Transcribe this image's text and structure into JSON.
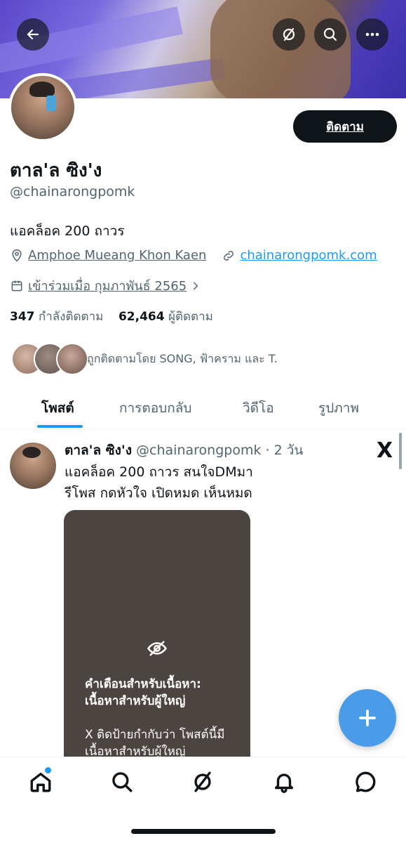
{
  "profile": {
    "name": "ตาล'ล ซิง'ง",
    "handle": "@chainarongpomk",
    "bio": "แอคล็อค 200 ถาวร",
    "location": "Amphoe Mueang Khon Kaen",
    "website": "chainarongpomk.com",
    "joined": "เข้าร่วมเมื่อ กุมภาพันธ์ 2565",
    "following_count": "347",
    "following_label": "กำลังติดตาม",
    "followers_count": "62,464",
    "followers_label": "ผู้ติดตาม",
    "followed_by": "ถูกติดตามโดย SONG, ฟ้าคราม และ T.",
    "follow_label": "ติดตาม"
  },
  "tabs": [
    {
      "label": "โพสต์",
      "active": true
    },
    {
      "label": "การตอบกลับ",
      "active": false
    },
    {
      "label": "วิดีโอ",
      "active": false
    },
    {
      "label": "รูปภาพ",
      "active": false
    }
  ],
  "post": {
    "author_name": "ตาล'ล ซิง'ง",
    "author_handle": "@chainarongpomk",
    "time": "· 2 วัน",
    "text_line1": "แอคล็อค 200 ถาวร สนใจDMมา",
    "text_line2": "รีโพส กดหัวใจ เปิดหมด เห็นหมด",
    "warning_title": "คำเตือนสำหรับเนื้อหา: เนื้อหาสำหรับผู้ใหญ่",
    "warning_body": "X ติดป้ายกำกับว่า โพสต์นี้มีเนื้อหาสำหรับผู้ใหญ่"
  },
  "icons": {
    "back": "arrow-left-icon",
    "grok": "grok-icon",
    "search": "search-icon",
    "more": "more-icon",
    "x_logo": "X"
  },
  "colors": {
    "accent": "#1d9bf0",
    "text": "#0f1419",
    "muted": "#536471",
    "fab": "#4a9be8",
    "media_bg": "#4c4440"
  }
}
